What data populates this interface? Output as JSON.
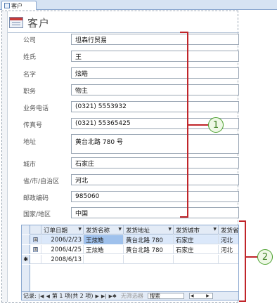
{
  "window": {
    "tab_label": "客户"
  },
  "form": {
    "title": "客户",
    "fields": [
      {
        "label": "公司",
        "value": "坦森行贸易"
      },
      {
        "label": "姓氏",
        "value": "王"
      },
      {
        "label": "名字",
        "value": "炫皓"
      },
      {
        "label": "职务",
        "value": "物主"
      },
      {
        "label": "业务电话",
        "value": "(0321) 5553932"
      },
      {
        "label": "传真号",
        "value": "(0321) 55365425"
      },
      {
        "label": "地址",
        "value": "黄台北路 780 号"
      },
      {
        "label": "城市",
        "value": "石家庄"
      },
      {
        "label": "省/市/自治区",
        "value": "河北"
      },
      {
        "label": "邮政编码",
        "value": "985060"
      },
      {
        "label": "国家/地区",
        "value": "中国"
      }
    ]
  },
  "subform": {
    "columns": [
      "订单日期",
      "发货名称",
      "发货地址",
      "发货城市",
      "发货省"
    ],
    "rows": [
      {
        "expander": "⊞",
        "date": "2006/2/23",
        "name": "王炫皓",
        "address": "黄台北路 780",
        "city": "石家庄",
        "province": "河北"
      },
      {
        "expander": "⊞",
        "date": "2006/4/25",
        "name": "王炫皓",
        "address": "黄台北路 780",
        "city": "石家庄",
        "province": "河北"
      }
    ],
    "new_row": {
      "marker": "✱",
      "date": "2008/6/13"
    },
    "nav": {
      "record_label": "记录:",
      "position": "第 1 项(共 2 项)",
      "filter": "无筛选器",
      "search": "搜索"
    }
  },
  "callouts": [
    "1",
    "2"
  ],
  "colors": {
    "callout_line": "#c0252a",
    "callout_circle": "#4aa02c",
    "selected_row": "#dbe8fa"
  }
}
